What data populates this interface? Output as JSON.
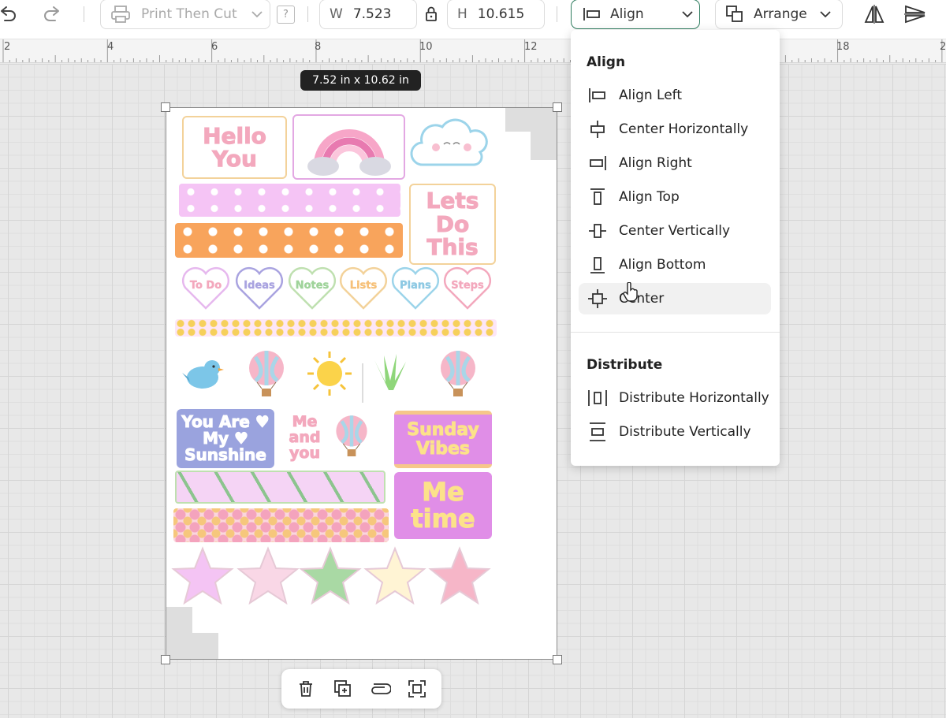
{
  "toolbar": {
    "operation": "Print Then Cut",
    "help_label": "?",
    "width_label": "W",
    "width_value": "7.523",
    "height_label": "H",
    "height_value": "10.615",
    "align_label": "Align",
    "arrange_label": "Arrange"
  },
  "ruler": {
    "ticks": [
      "2",
      "4",
      "6",
      "8",
      "10",
      "12",
      "18",
      "2"
    ]
  },
  "canvas": {
    "size_badge": "7.52  in x 10.62  in"
  },
  "stickers": {
    "hello": "Hello You",
    "lets": "Lets Do This",
    "hearts": [
      "To Do",
      "Ideas",
      "Notes",
      "Lists",
      "Plans",
      "Steps"
    ],
    "sunshine": "You Are ♥ My ♥ Sunshine",
    "me_and_you": "Me and you",
    "sunday": "Sunday Vibes",
    "me_time": "Me time"
  },
  "align_menu": {
    "align_heading": "Align",
    "items": [
      {
        "label": "Align Left",
        "icon": "align-left-icon"
      },
      {
        "label": "Center Horizontally",
        "icon": "center-horizontally-icon"
      },
      {
        "label": "Align Right",
        "icon": "align-right-icon"
      },
      {
        "label": "Align Top",
        "icon": "align-top-icon"
      },
      {
        "label": "Center Vertically",
        "icon": "center-vertically-icon"
      },
      {
        "label": "Align Bottom",
        "icon": "align-bottom-icon"
      },
      {
        "label": "Center",
        "icon": "center-icon"
      }
    ],
    "distribute_heading": "Distribute",
    "distribute_items": [
      {
        "label": "Distribute Horizontally",
        "icon": "distribute-horizontally-icon"
      },
      {
        "label": "Distribute Vertically",
        "icon": "distribute-vertically-icon"
      }
    ]
  },
  "colors": {
    "accent": "#2f7d5f",
    "pink": "#f08fb6",
    "orange": "#f8a45c",
    "lavender": "#a9a3e0",
    "purple": "#d98be3"
  }
}
